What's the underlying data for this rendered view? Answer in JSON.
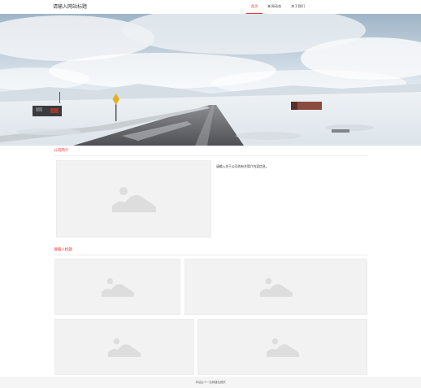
{
  "header": {
    "site_title": "请输入网站标题",
    "nav": [
      {
        "label": "首页",
        "active": true
      },
      {
        "label": "新闻动态",
        "active": false
      },
      {
        "label": "关于我们",
        "active": false
      }
    ]
  },
  "about": {
    "title": "公司简介",
    "text": "请输入关于公司的有关简介内容信息。"
  },
  "works": {
    "title": "请输入标题"
  },
  "footer": {
    "text": "本站由 ©一站网建站提供"
  },
  "colors": {
    "accent": "#ee3333",
    "placeholder_bg": "#f2f2f2",
    "placeholder_icon": "#dddddd"
  },
  "icons": {
    "placeholder": "image-placeholder-icon"
  }
}
